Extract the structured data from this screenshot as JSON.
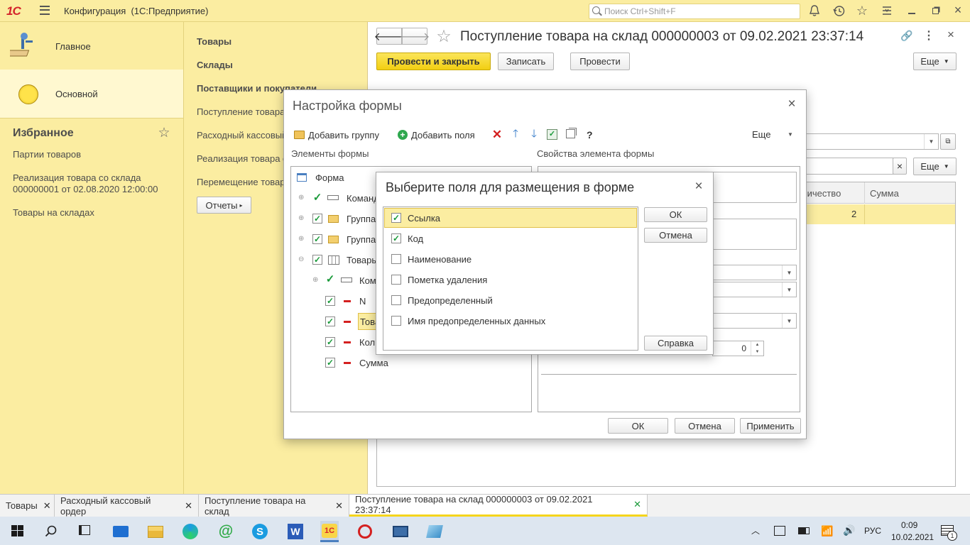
{
  "topbar": {
    "logo": "1С",
    "title": "Конфигурация  (1С:Предприятие)",
    "search_placeholder": "Поиск Ctrl+Shift+F"
  },
  "sections": [
    {
      "label": "Главное"
    },
    {
      "label": "Основной"
    }
  ],
  "favorites": {
    "title": "Избранное",
    "items": [
      "Партии товаров",
      "Реализация товара со склада 000000001 от 02.08.2020 12:00:00",
      "Товары на складах"
    ]
  },
  "nav": {
    "bold_links": [
      "Товары",
      "Склады",
      "Поставщики и покупатели"
    ],
    "links": [
      "Поступление товара",
      "Расходный кассовый",
      "Реализация товара с",
      "Перемещение товар"
    ],
    "reports_button": "Отчеты"
  },
  "document": {
    "title": "Поступление товара на склад 000000003 от 09.02.2021 23:37:14",
    "post_close": "Провести и закрыть",
    "save": "Записать",
    "post": "Провести",
    "more": "Еще",
    "more2": "Еще",
    "table_headers": [
      "личество",
      "Сумма"
    ],
    "row_value": "2"
  },
  "form_settings": {
    "title": "Настройка формы",
    "add_group": "Добавить группу",
    "add_fields": "Добавить поля",
    "help_mark": "?",
    "more": "Еще",
    "elements_label": "Элементы формы",
    "props_label": "Свойства элемента формы",
    "tree": [
      "Форма",
      "Команд",
      "Группа",
      "Группа",
      "Товары",
      "Ком",
      "N",
      "Това",
      "Кол",
      "Сумма"
    ],
    "spin_value": "0",
    "ok": "ОК",
    "cancel": "Отмена",
    "apply": "Применить"
  },
  "field_picker": {
    "title": "Выберите поля для размещения в форме",
    "fields": [
      {
        "label": "Ссылка",
        "checked": true
      },
      {
        "label": "Код",
        "checked": true
      },
      {
        "label": "Наименование",
        "checked": false
      },
      {
        "label": "Пометка удаления",
        "checked": false
      },
      {
        "label": "Предопределенный",
        "checked": false
      },
      {
        "label": "Имя предопределенных данных",
        "checked": false
      }
    ],
    "ok": "ОК",
    "cancel": "Отмена",
    "help": "Справка"
  },
  "tabs": [
    {
      "label": "Товары"
    },
    {
      "label": "Расходный кассовый ордер"
    },
    {
      "label": "Поступление товара на склад"
    },
    {
      "label": "Поступление товара на склад 000000003 от 09.02.2021 23:37:14"
    }
  ],
  "taskbar": {
    "lang": "РУС",
    "time": "0:09",
    "date": "10.02.2021",
    "notifications": "1"
  },
  "colors": {
    "panel": "#fbeda1",
    "accent_button": "#f5d51c",
    "check": "#1a9a3a"
  }
}
